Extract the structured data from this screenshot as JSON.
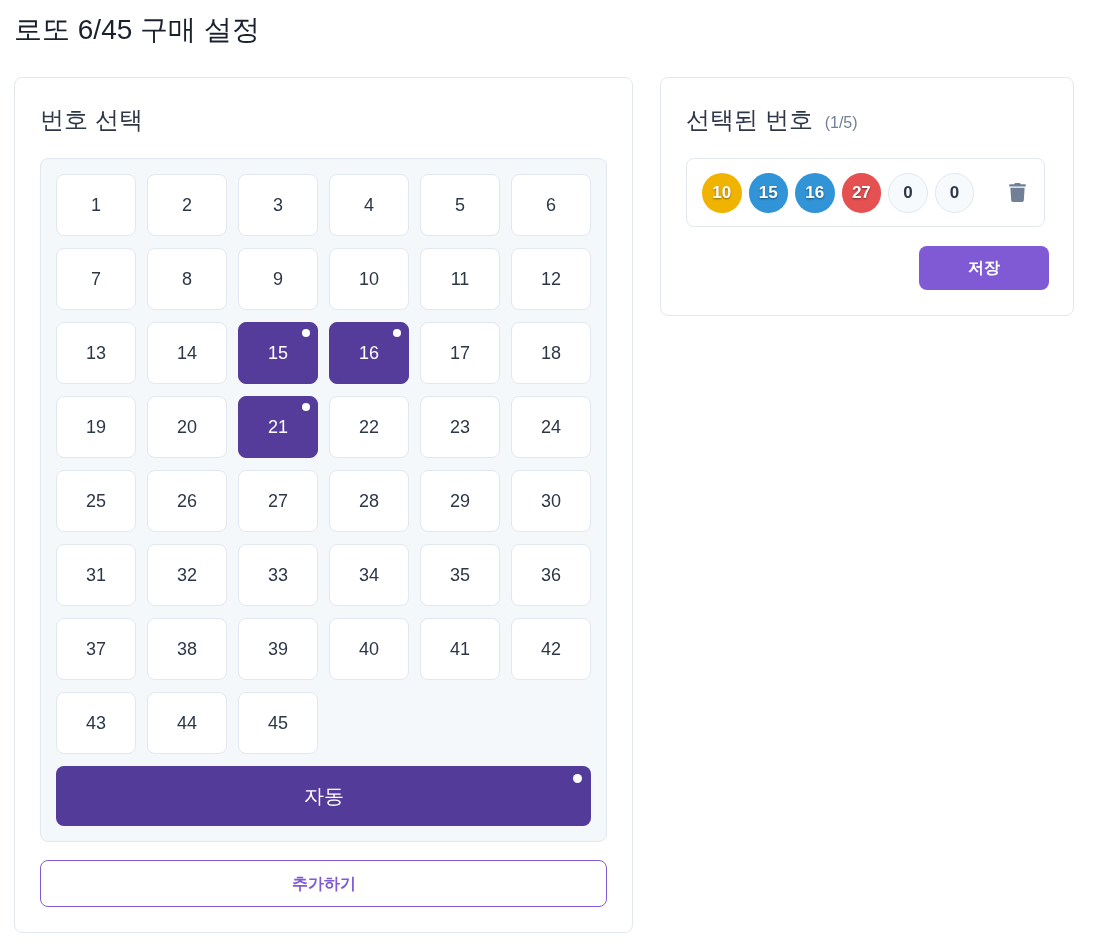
{
  "title": "로또 6/45 구매 설정",
  "number_panel": {
    "heading": "번호 선택",
    "numbers": [
      {
        "label": "1",
        "selected": false
      },
      {
        "label": "2",
        "selected": false
      },
      {
        "label": "3",
        "selected": false
      },
      {
        "label": "4",
        "selected": false
      },
      {
        "label": "5",
        "selected": false
      },
      {
        "label": "6",
        "selected": false
      },
      {
        "label": "7",
        "selected": false
      },
      {
        "label": "8",
        "selected": false
      },
      {
        "label": "9",
        "selected": false
      },
      {
        "label": "10",
        "selected": false
      },
      {
        "label": "11",
        "selected": false
      },
      {
        "label": "12",
        "selected": false
      },
      {
        "label": "13",
        "selected": false
      },
      {
        "label": "14",
        "selected": false
      },
      {
        "label": "15",
        "selected": true
      },
      {
        "label": "16",
        "selected": true
      },
      {
        "label": "17",
        "selected": false
      },
      {
        "label": "18",
        "selected": false
      },
      {
        "label": "19",
        "selected": false
      },
      {
        "label": "20",
        "selected": false
      },
      {
        "label": "21",
        "selected": true
      },
      {
        "label": "22",
        "selected": false
      },
      {
        "label": "23",
        "selected": false
      },
      {
        "label": "24",
        "selected": false
      },
      {
        "label": "25",
        "selected": false
      },
      {
        "label": "26",
        "selected": false
      },
      {
        "label": "27",
        "selected": false
      },
      {
        "label": "28",
        "selected": false
      },
      {
        "label": "29",
        "selected": false
      },
      {
        "label": "30",
        "selected": false
      },
      {
        "label": "31",
        "selected": false
      },
      {
        "label": "32",
        "selected": false
      },
      {
        "label": "33",
        "selected": false
      },
      {
        "label": "34",
        "selected": false
      },
      {
        "label": "35",
        "selected": false
      },
      {
        "label": "36",
        "selected": false
      },
      {
        "label": "37",
        "selected": false
      },
      {
        "label": "38",
        "selected": false
      },
      {
        "label": "39",
        "selected": false
      },
      {
        "label": "40",
        "selected": false
      },
      {
        "label": "41",
        "selected": false
      },
      {
        "label": "42",
        "selected": false
      },
      {
        "label": "43",
        "selected": false
      },
      {
        "label": "44",
        "selected": false
      },
      {
        "label": "45",
        "selected": false
      }
    ],
    "auto_button": {
      "label": "자동",
      "selected": true
    },
    "add_button": "추가하기"
  },
  "selected_panel": {
    "heading": "선택된 번호",
    "count": "(1/5)",
    "balls": [
      {
        "label": "10",
        "kind": "number",
        "color": "#f0b400"
      },
      {
        "label": "15",
        "kind": "number",
        "color": "#3094d6"
      },
      {
        "label": "16",
        "kind": "number",
        "color": "#3094d6"
      },
      {
        "label": "27",
        "kind": "number",
        "color": "#e55050"
      },
      {
        "label": "0",
        "kind": "empty"
      },
      {
        "label": "0",
        "kind": "empty"
      }
    ],
    "save_button": "저장"
  }
}
